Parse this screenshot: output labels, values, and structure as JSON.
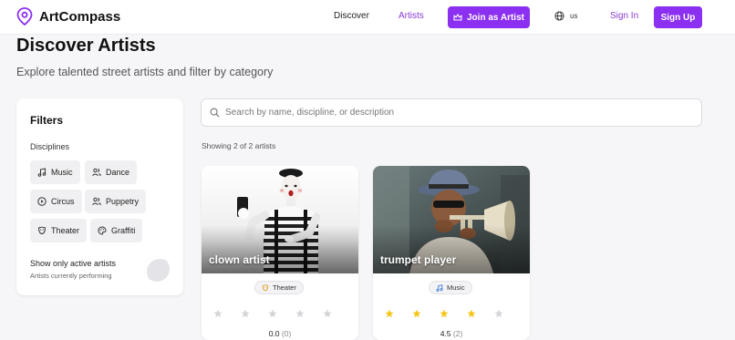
{
  "brand": {
    "name": "ArtCompass"
  },
  "nav": {
    "discover": "Discover",
    "artists": "Artists",
    "join": "Join as Artist",
    "lang": "us",
    "signin": "Sign In",
    "signup": "Sign Up"
  },
  "header": {
    "title": "Discover Artists",
    "subtitle": "Explore talented street artists and filter by category"
  },
  "filters": {
    "title": "Filters",
    "disciplines_label": "Disciplines",
    "disciplines": [
      {
        "label": "Music",
        "icon": "music-note-icon"
      },
      {
        "label": "Dance",
        "icon": "people-icon"
      },
      {
        "label": "Circus",
        "icon": "play-circle-icon"
      },
      {
        "label": "Puppetry",
        "icon": "people-icon"
      },
      {
        "label": "Theater",
        "icon": "mask-icon"
      },
      {
        "label": "Graffiti",
        "icon": "palette-icon"
      }
    ],
    "active_label": "Show only active artists",
    "active_sub": "Artists currently performing",
    "active_only": false
  },
  "search": {
    "placeholder": "Search by name, discipline, or description",
    "value": ""
  },
  "results": {
    "showing": "Showing 2 of 2 artists"
  },
  "artists": [
    {
      "name": "clown artist",
      "discipline": "Theater",
      "rating": "0.0",
      "reviews": "(0)",
      "stars_filled": 0
    },
    {
      "name": "trumpet player",
      "discipline": "Music",
      "rating": "4.5",
      "reviews": "(2)",
      "stars_filled": 4
    }
  ],
  "colors": {
    "accent": "#8b2ff0",
    "accent_text": "#8a3ad6",
    "star_filled": "#f5c518",
    "star_empty": "#d4d4d8"
  }
}
